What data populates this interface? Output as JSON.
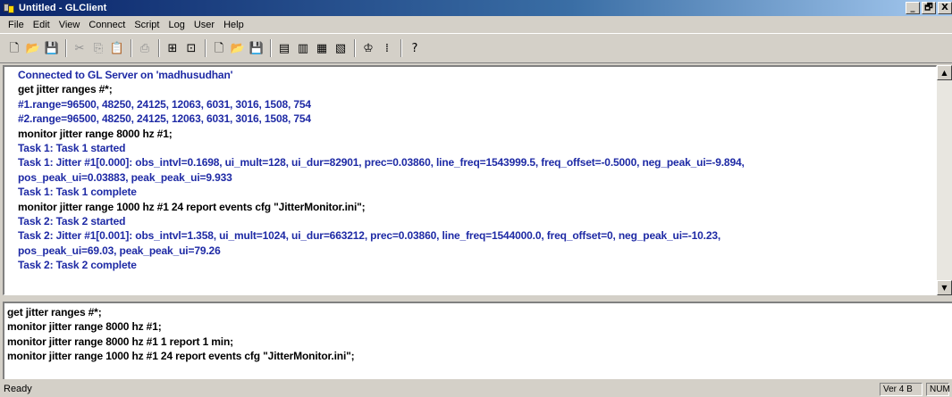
{
  "window": {
    "title": "Untitled - GLClient",
    "controls": [
      "_",
      "🗗",
      "X"
    ]
  },
  "menu": [
    "File",
    "Edit",
    "View",
    "Connect",
    "Script",
    "Log",
    "User",
    "Help"
  ],
  "toolbar": {
    "groups": [
      [
        {
          "icon": "new-file-icon",
          "glyph": "🗋",
          "enabled": true
        },
        {
          "icon": "open-folder-icon",
          "glyph": "📂",
          "enabled": true
        },
        {
          "icon": "save-icon",
          "glyph": "💾",
          "enabled": true
        }
      ],
      [
        {
          "icon": "cut-icon",
          "glyph": "✂",
          "enabled": false
        },
        {
          "icon": "copy-icon",
          "glyph": "⎘",
          "enabled": false
        },
        {
          "icon": "paste-icon",
          "glyph": "📋",
          "enabled": true
        }
      ],
      [
        {
          "icon": "print-icon",
          "glyph": "⎙",
          "enabled": false
        }
      ],
      [
        {
          "icon": "connect-icon",
          "glyph": "⊞",
          "enabled": true
        },
        {
          "icon": "network-icon",
          "glyph": "⊡",
          "enabled": true
        }
      ],
      [
        {
          "icon": "new-script-icon",
          "glyph": "🗋",
          "enabled": true
        },
        {
          "icon": "open-script-icon",
          "glyph": "📂",
          "enabled": true
        },
        {
          "icon": "save-script-icon",
          "glyph": "💾",
          "enabled": false
        }
      ],
      [
        {
          "icon": "log-icon",
          "glyph": "▤",
          "enabled": true
        },
        {
          "icon": "log-view-icon",
          "glyph": "▥",
          "enabled": true
        },
        {
          "icon": "log-send-icon",
          "glyph": "▦",
          "enabled": true
        },
        {
          "icon": "log-export-icon",
          "glyph": "▧",
          "enabled": true
        }
      ],
      [
        {
          "icon": "hierarchy-icon",
          "glyph": "♔",
          "enabled": true
        },
        {
          "icon": "status-icon",
          "glyph": "⁞",
          "enabled": true
        }
      ],
      [
        {
          "icon": "help-icon",
          "glyph": "?",
          "enabled": true
        }
      ]
    ]
  },
  "output": {
    "lines": [
      {
        "text": "Connected to GL Server on 'madhusudhan'",
        "color": "blue"
      },
      {
        "text": "get jitter ranges #*;",
        "color": "black"
      },
      {
        "text": "#1.range=96500, 48250, 24125, 12063, 6031, 3016, 1508, 754",
        "color": "blue"
      },
      {
        "text": "#2.range=96500, 48250, 24125, 12063, 6031, 3016, 1508, 754",
        "color": "blue"
      },
      {
        "text": "monitor jitter range 8000 hz #1;",
        "color": "black"
      },
      {
        "text": "Task 1: Task 1 started",
        "color": "blue"
      },
      {
        "text": "Task 1: Jitter #1[0.000]: obs_intvl=0.1698, ui_mult=128, ui_dur=82901, prec=0.03860, line_freq=1543999.5, freq_offset=-0.5000, neg_peak_ui=-9.894,",
        "color": "blue"
      },
      {
        "text": "pos_peak_ui=0.03883, peak_peak_ui=9.933",
        "color": "blue"
      },
      {
        "text": "Task 1: Task 1 complete",
        "color": "blue"
      },
      {
        "text": "monitor jitter range 1000 hz #1 24 report events cfg \"JitterMonitor.ini\";",
        "color": "black"
      },
      {
        "text": "Task 2: Task 2 started",
        "color": "blue"
      },
      {
        "text": "Task 2: Jitter #1[0.001]: obs_intvl=1.358, ui_mult=1024, ui_dur=663212, prec=0.03860, line_freq=1544000.0, freq_offset=0, neg_peak_ui=-10.23,",
        "color": "blue"
      },
      {
        "text": "pos_peak_ui=69.03, peak_peak_ui=79.26",
        "color": "blue"
      },
      {
        "text": "Task 2: Task 2 complete",
        "color": "blue"
      }
    ]
  },
  "input": {
    "lines": [
      "get jitter ranges #*;",
      "monitor jitter range 8000 hz #1;",
      "monitor jitter range 8000 hz #1 1 report 1 min;",
      "monitor jitter range 1000 hz #1 24 report events cfg \"JitterMonitor.ini\";"
    ]
  },
  "status": {
    "text": "Ready",
    "version": "Ver 4 B",
    "num": "NUM"
  },
  "colors": {
    "blue_text": "#1e2aa5",
    "black_text": "#000000"
  }
}
